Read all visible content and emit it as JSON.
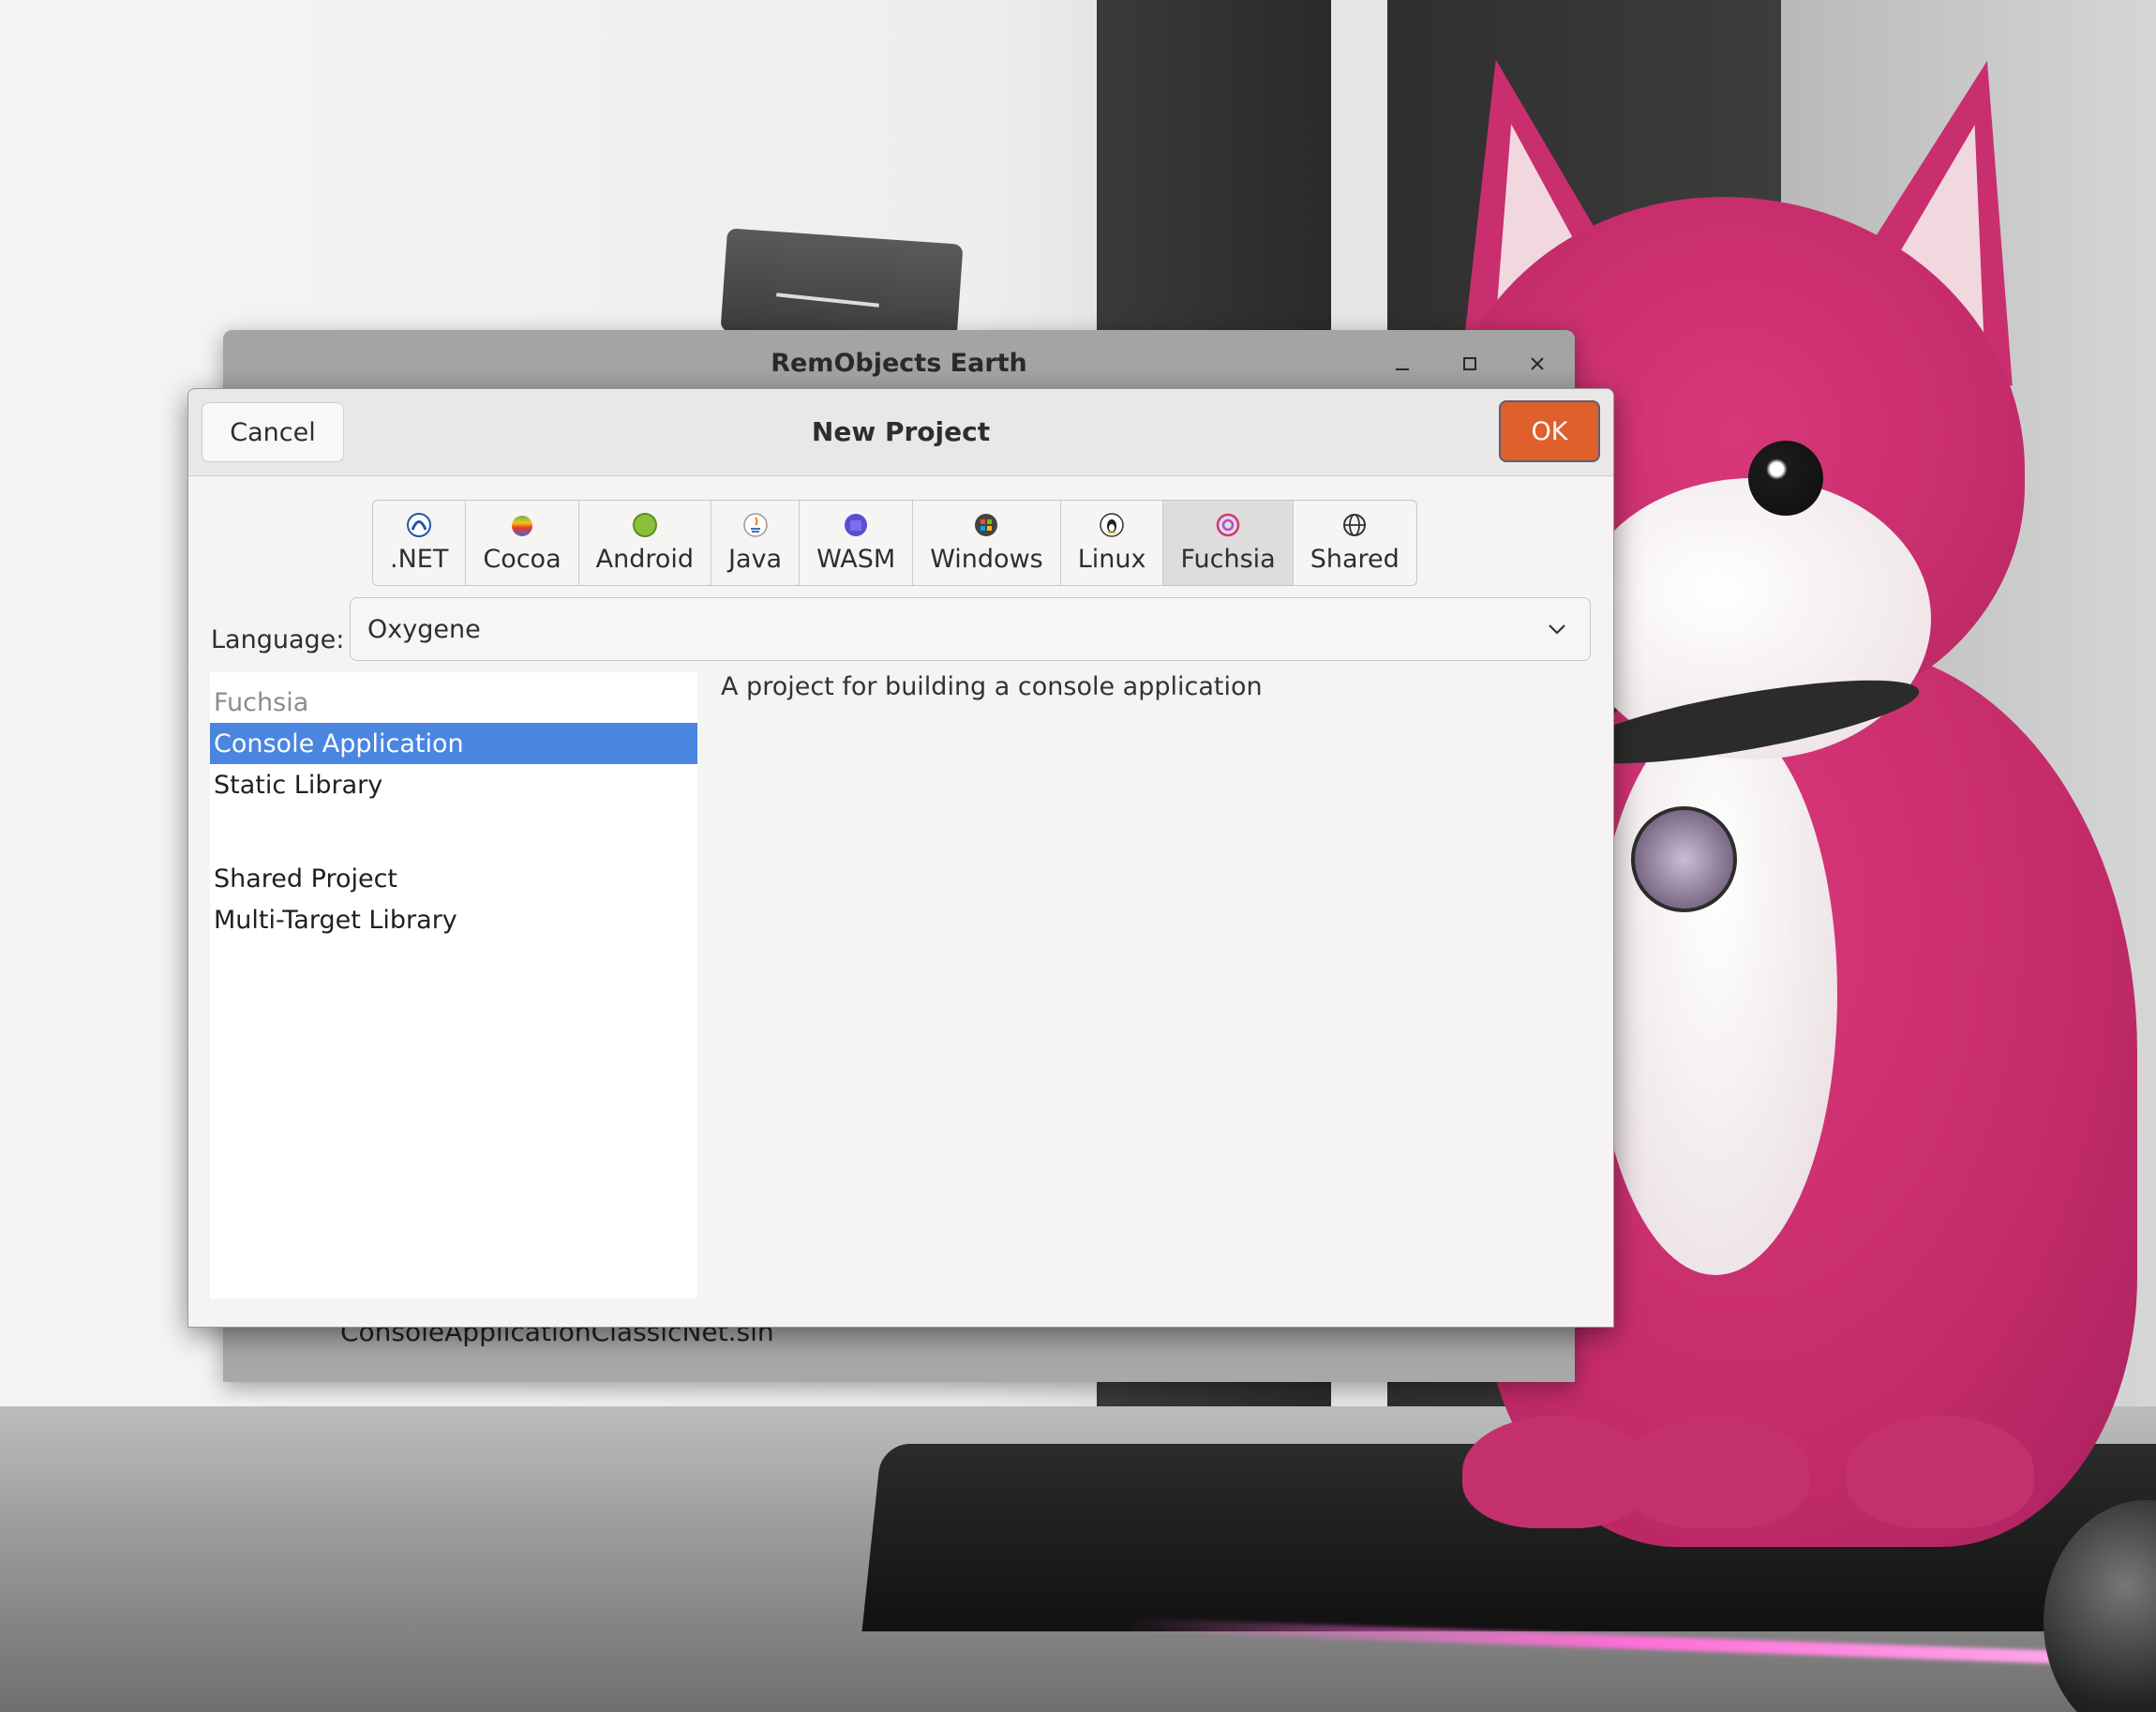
{
  "background_window": {
    "title": "RemObjects Earth",
    "footer_text": "ConsoleApplicationClassicNet.sln"
  },
  "dialog": {
    "title": "New Project",
    "cancel_label": "Cancel",
    "ok_label": "OK",
    "ok_color": "#e0602b",
    "tabs": [
      {
        "label": ".NET",
        "icon": "dotnet-icon"
      },
      {
        "label": "Cocoa",
        "icon": "apple-icon"
      },
      {
        "label": "Android",
        "icon": "android-icon"
      },
      {
        "label": "Java",
        "icon": "java-icon"
      },
      {
        "label": "WASM",
        "icon": "wasm-icon"
      },
      {
        "label": "Windows",
        "icon": "windows-icon"
      },
      {
        "label": "Linux",
        "icon": "linux-icon"
      },
      {
        "label": "Fuchsia",
        "icon": "fuchsia-icon",
        "active": true
      },
      {
        "label": "Shared",
        "icon": "globe-icon"
      }
    ],
    "language": {
      "label": "Language:",
      "value": "Oxygene"
    },
    "templates": {
      "group_fuchsia": "Fuchsia",
      "console_application": "Console Application",
      "static_library": "Static Library",
      "shared_project": "Shared Project",
      "multi_target_library": "Multi-Target Library",
      "selected_color": "#4a86e0"
    },
    "description": "A project for building a console application"
  }
}
